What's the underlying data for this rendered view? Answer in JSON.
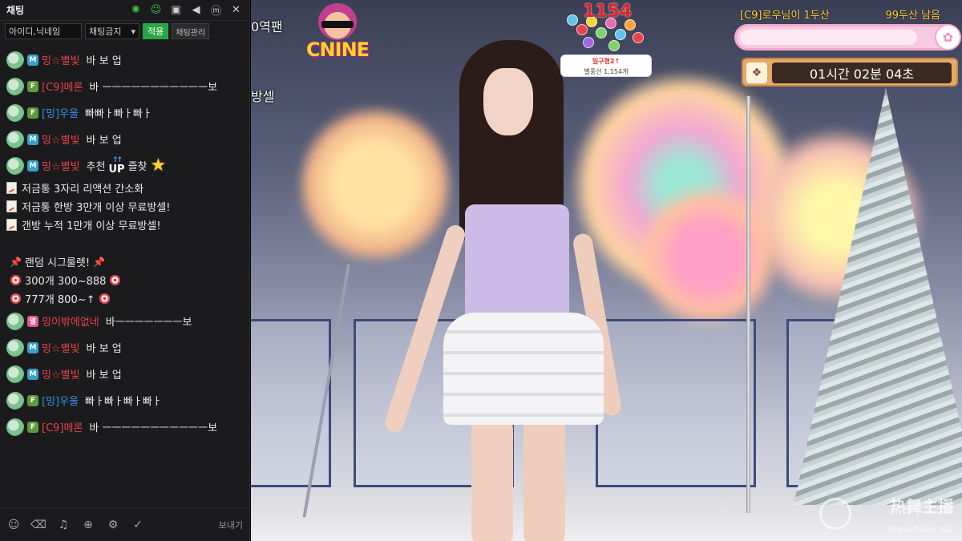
{
  "chat": {
    "title": "채팅",
    "header_icons": [
      "settings-sun-icon",
      "user-online-icon",
      "gift-icon",
      "megaphone-icon",
      "m-badge-icon",
      "close-icon"
    ],
    "close_label": "✕",
    "filter": {
      "input_value": "아이디,닉네임",
      "select_value": "채팅금지",
      "apply_label": "적용",
      "manage_label": "채팅관리"
    },
    "messages": [
      {
        "badge": "M",
        "nick": "밍☆별빛",
        "nick_color": "#e8424b",
        "text": "바 보 업"
      },
      {
        "badge": "F",
        "nick": "[C9]메론",
        "nick_color": "#e8424b",
        "text": "바 ㅡㅡㅡㅡㅡㅡㅡㅡㅡㅡㅡ보"
      },
      {
        "badge": "F",
        "nick": "[밍]우울",
        "nick_color": "#3c8ee6",
        "text": "빠빠ㅏ빠ㅏ빠ㅏ"
      },
      {
        "badge": "M",
        "nick": "밍☆별빛",
        "nick_color": "#e8424b",
        "text": "바 보 업"
      },
      {
        "badge": "M",
        "nick": "밍☆별빛",
        "nick_color": "#e8424b",
        "text": "추천",
        "text2": "즐찾",
        "up_label": "UP"
      }
    ],
    "notices": [
      "저금통 3자리 리액션 간소화",
      "저금통 한방 3만개 이상 무료방셀!",
      "갠방 누적 1만개 이상 무료방셀!"
    ],
    "roulette": {
      "title": "랜덤 시그룰렛!",
      "lines": [
        "300개 300~888",
        "777개 800~↑"
      ]
    },
    "messages2": [
      {
        "badge": "열",
        "nick": "밍이밖에없네",
        "nick_color": "#e8424b",
        "text": "바ㅡㅡㅡㅡㅡㅡㅡ보"
      },
      {
        "badge": "M",
        "nick": "밍☆별빛",
        "nick_color": "#e8424b",
        "text": "바 보 업"
      },
      {
        "badge": "M",
        "nick": "밍☆별빛",
        "nick_color": "#e8424b",
        "text": "바 보 업"
      },
      {
        "badge": "F",
        "nick": "[밍]우울",
        "nick_color": "#3c8ee6",
        "text": "빠ㅏ빠ㅏ빠ㅏ빠ㅏ"
      },
      {
        "badge": "F",
        "nick": "[C9]메론",
        "nick_color": "#e8424b",
        "text": "바 ㅡㅡㅡㅡㅡㅡㅡㅡㅡㅡㅡ보"
      }
    ],
    "footer": {
      "icons": [
        "emoji-icon",
        "eraser-icon",
        "bell-icon",
        "globe-icon",
        "settings-icon",
        "check-circle-icon"
      ],
      "send_label": "보내기"
    }
  },
  "stream": {
    "left_overlay_1": "0역팬",
    "left_overlay_2": "방셀",
    "logo_text": "CNINE",
    "balloon_count": "1154",
    "balloon_card_line1": "밀구형2↑",
    "balloon_card_line2": "별풍선 1,154개",
    "top_left_label": "[C9]로우님이 1두산",
    "top_right_label": "99두산 남음",
    "progress_fraction": 0.84,
    "timer": "01시간 02분 04초",
    "watermark": "热舞主播",
    "watermark_url": "rewuzhubo.vip"
  },
  "colors": {
    "chat_bg": "#1b1b1d",
    "apply_green": "#27a844",
    "nick_red": "#e8424b",
    "nick_blue": "#3c8ee6",
    "badge_m": "#3aa0c8",
    "badge_f": "#5c9a3d",
    "balloon_red": "#e81e25",
    "goal_yellow": "#ffd23c"
  }
}
